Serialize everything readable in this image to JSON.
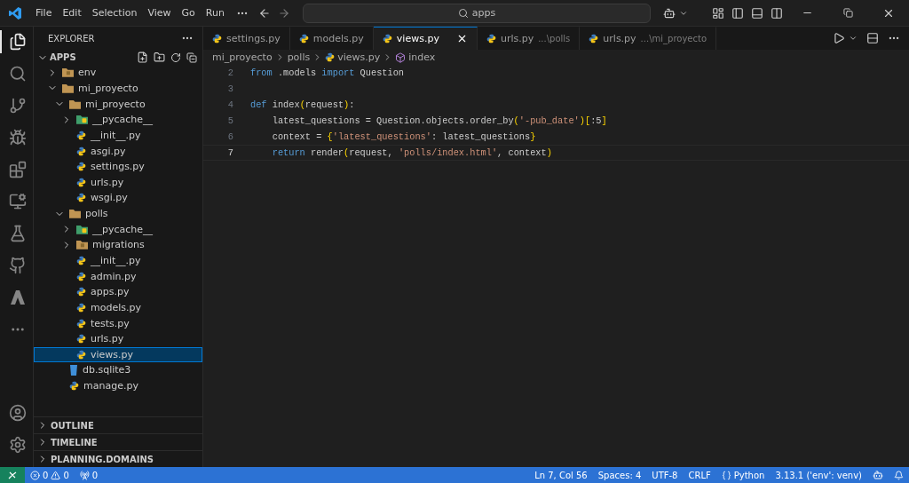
{
  "title_bar": {
    "menu": [
      "File",
      "Edit",
      "Selection",
      "View",
      "Go",
      "Run"
    ],
    "search": {
      "value": "apps"
    }
  },
  "sidebar": {
    "title": "EXPLORER",
    "root": {
      "label": "APPS",
      "expanded": true
    },
    "tree": [
      {
        "label": "env",
        "kind": "package",
        "expanded": false,
        "selected": false
      },
      {
        "label": "mi_proyecto",
        "kind": "folder",
        "expanded": true,
        "selected": false,
        "children": [
          {
            "label": "mi_proyecto",
            "kind": "folder",
            "expanded": true,
            "selected": false,
            "children": [
              {
                "label": "__pycache__",
                "kind": "pycache",
                "expanded": false,
                "selected": false
              },
              {
                "label": "__init__.py",
                "kind": "python",
                "selected": false
              },
              {
                "label": "asgi.py",
                "kind": "python",
                "selected": false
              },
              {
                "label": "settings.py",
                "kind": "python",
                "selected": false
              },
              {
                "label": "urls.py",
                "kind": "python",
                "selected": false
              },
              {
                "label": "wsgi.py",
                "kind": "python",
                "selected": false
              }
            ]
          },
          {
            "label": "polls",
            "kind": "folder",
            "expanded": true,
            "selected": false,
            "children": [
              {
                "label": "__pycache__",
                "kind": "pycache",
                "expanded": false,
                "selected": false
              },
              {
                "label": "migrations",
                "kind": "package",
                "expanded": false,
                "selected": false
              },
              {
                "label": "__init__.py",
                "kind": "python",
                "selected": false
              },
              {
                "label": "admin.py",
                "kind": "python",
                "selected": false
              },
              {
                "label": "apps.py",
                "kind": "python",
                "selected": false
              },
              {
                "label": "models.py",
                "kind": "python",
                "selected": false
              },
              {
                "label": "tests.py",
                "kind": "python",
                "selected": false
              },
              {
                "label": "urls.py",
                "kind": "python",
                "selected": false
              },
              {
                "label": "views.py",
                "kind": "python",
                "selected": true
              }
            ]
          },
          {
            "label": "db.sqlite3",
            "kind": "db",
            "selected": false
          },
          {
            "label": "manage.py",
            "kind": "python",
            "selected": false
          }
        ]
      }
    ],
    "sections": [
      {
        "label": "OUTLINE",
        "expanded": false
      },
      {
        "label": "TIMELINE",
        "expanded": false
      },
      {
        "label": "PLANNING.DOMAINS",
        "expanded": false
      }
    ]
  },
  "tabs": [
    {
      "label": "settings.py",
      "selected": false
    },
    {
      "label": "models.py",
      "selected": false
    },
    {
      "label": "views.py",
      "selected": true
    },
    {
      "label": "urls.py",
      "hint": "...\\polls",
      "selected": false
    },
    {
      "label": "urls.py",
      "hint": "...\\mi_proyecto",
      "selected": false
    }
  ],
  "breadcrumb": [
    {
      "label": "mi_proyecto",
      "kind": "folder"
    },
    {
      "label": "polls",
      "kind": "folder"
    },
    {
      "label": "views.py",
      "kind": "python"
    },
    {
      "label": "index",
      "kind": "symbol"
    }
  ],
  "editor": {
    "lines": [
      {
        "number": "2",
        "current": false,
        "tokens": [
          {
            "text": "from",
            "kind": "keyword"
          },
          {
            "text": " .models ",
            "kind": "plain"
          },
          {
            "text": "import",
            "kind": "keyword"
          },
          {
            "text": " Question",
            "kind": "plain"
          }
        ]
      },
      {
        "number": "3",
        "current": false
      },
      {
        "number": "4",
        "current": false,
        "tokens": [
          {
            "text": "def",
            "kind": "keyword"
          },
          {
            "text": " index",
            "kind": "plain"
          },
          {
            "text": "(",
            "kind": "bracket"
          },
          {
            "text": "request",
            "kind": "plain"
          },
          {
            "text": ")",
            "kind": "bracket"
          },
          {
            "text": ":",
            "kind": "plain"
          }
        ]
      },
      {
        "number": "5",
        "current": false,
        "tokens": [
          {
            "text": "    latest_questions = Question.objects.order_by",
            "kind": "plain"
          },
          {
            "text": "(",
            "kind": "bracket"
          },
          {
            "text": "'-pub_date'",
            "kind": "string"
          },
          {
            "text": ")",
            "kind": "bracket"
          },
          {
            "text": "[",
            "kind": "bracket"
          },
          {
            "text": ":5",
            "kind": "plain"
          },
          {
            "text": "]",
            "kind": "bracket"
          }
        ]
      },
      {
        "number": "6",
        "current": false,
        "tokens": [
          {
            "text": "    context = ",
            "kind": "plain"
          },
          {
            "text": "{",
            "kind": "bracket"
          },
          {
            "text": "'latest_questions'",
            "kind": "string"
          },
          {
            "text": ": latest_questions",
            "kind": "plain"
          },
          {
            "text": "}",
            "kind": "bracket"
          }
        ]
      },
      {
        "number": "7",
        "current": true,
        "tokens": [
          {
            "text": "    return",
            "kind": "keyword"
          },
          {
            "text": " render",
            "kind": "plain"
          },
          {
            "text": "(",
            "kind": "bracket"
          },
          {
            "text": "request, ",
            "kind": "plain"
          },
          {
            "text": "'polls/index.html'",
            "kind": "string"
          },
          {
            "text": ", context",
            "kind": "plain"
          },
          {
            "text": ")",
            "kind": "bracket"
          }
        ]
      }
    ]
  },
  "status_bar": {
    "errors": "0",
    "warnings": "0",
    "ports": "0",
    "position": "Ln 7, Col 56",
    "spaces": "Spaces: 4",
    "encoding": "UTF-8",
    "eol": "CRLF",
    "language": "Python",
    "interpreter": "3.13.1 ('env': venv)"
  }
}
